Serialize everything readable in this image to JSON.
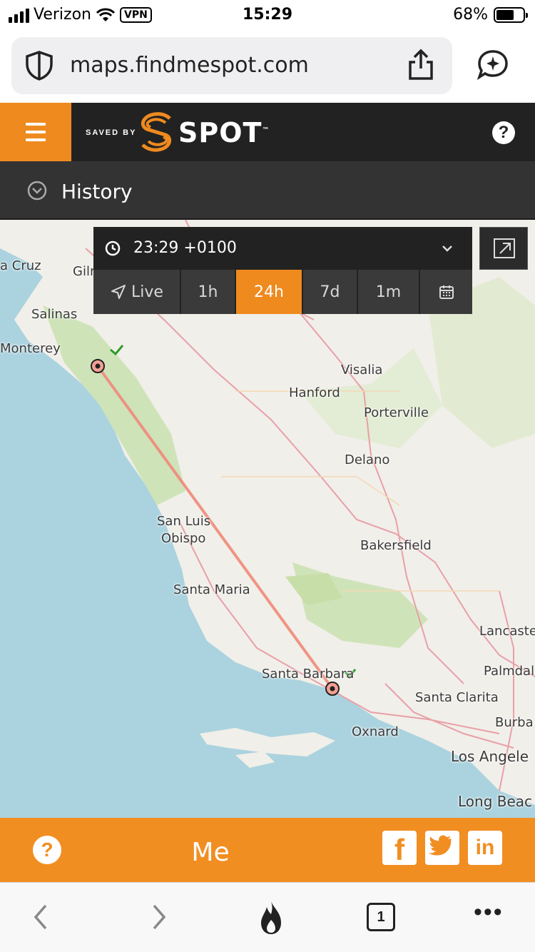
{
  "status_bar": {
    "carrier": "Verizon",
    "vpn": "VPN",
    "time": "15:29",
    "battery": "68%",
    "battery_level": 0.68
  },
  "browser": {
    "url": "maps.findmespot.com"
  },
  "header": {
    "tagline": "SAVED BY",
    "brand": "SPOT",
    "brand_mark": "™"
  },
  "history_bar": {
    "label": "History"
  },
  "time_panel": {
    "time": "23:29 +0100",
    "tabs": [
      {
        "label": "Live",
        "icon": "navigation-arrow-icon"
      },
      {
        "label": "1h"
      },
      {
        "label": "24h",
        "active": true
      },
      {
        "label": "7d"
      },
      {
        "label": "1m"
      },
      {
        "label": "",
        "icon": "calendar-icon"
      }
    ]
  },
  "map": {
    "labels": [
      "a Cruz",
      "Gilr",
      "Salinas",
      "Monterey",
      "Visalia",
      "Hanford",
      "Porterville",
      "Delano",
      "San Luis",
      "Obispo",
      "Bakersfield",
      "Santa Maria",
      "Lancaste",
      "Palmdal",
      "Santa Barbara",
      "Santa Clarita",
      "Oxnard",
      "Burba",
      "Los Angele",
      "Long Beac"
    ]
  },
  "footer": {
    "label": "Me",
    "socials": [
      "facebook-icon",
      "twitter-icon",
      "linkedin-icon"
    ],
    "accent": "#f18e22"
  },
  "colors": {
    "accent": "#ef8a1f",
    "header_bg": "#222222",
    "history_bg": "#333333",
    "track": "#f08a7a"
  }
}
